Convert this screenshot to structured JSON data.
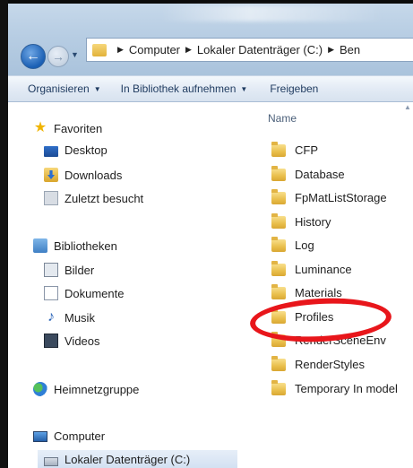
{
  "address": {
    "crumbs": [
      "Computer",
      "Lokaler Datenträger (C:)",
      "Ben"
    ]
  },
  "toolbar": {
    "organize_label": "Organisieren",
    "library_label": "In Bibliothek aufnehmen",
    "share_label": "Freigeben"
  },
  "nav": {
    "favorites": "Favoriten",
    "desktop": "Desktop",
    "downloads": "Downloads",
    "recent": "Zuletzt besucht",
    "libraries": "Bibliotheken",
    "pictures": "Bilder",
    "documents": "Dokumente",
    "music": "Musik",
    "videos": "Videos",
    "homegroup": "Heimnetzgruppe",
    "computer": "Computer",
    "local_disk": "Lokaler Datenträger (C:)"
  },
  "content": {
    "column_name": "Name",
    "files": [
      "CFP",
      "Database",
      "FpMatListStorage",
      "History",
      "Log",
      "Luminance",
      "Materials",
      "Profiles",
      "RenderSceneEnv",
      "RenderStyles",
      "Temporary In model"
    ]
  },
  "annotation": {
    "highlight_color": "#e8161b",
    "highlighted_item": "Profiles"
  }
}
